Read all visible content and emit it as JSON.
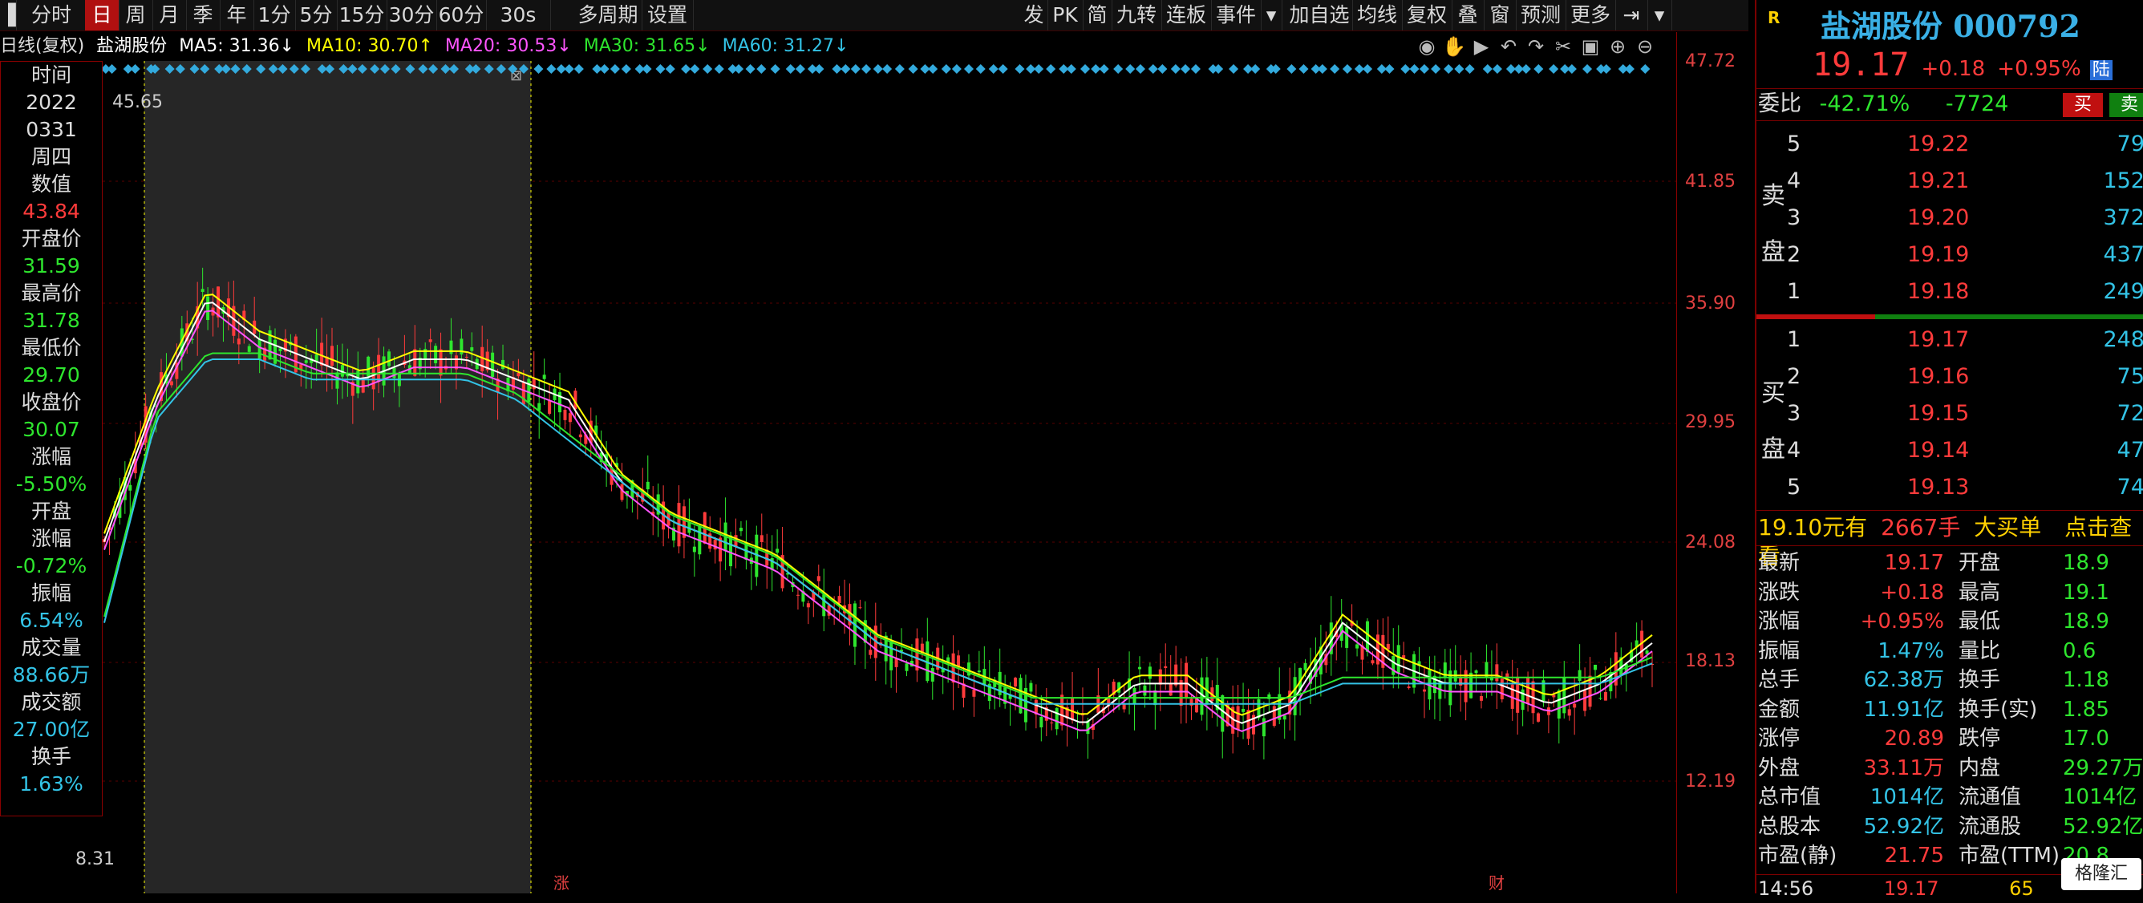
{
  "toolbar": {
    "left": [
      "分时",
      "日",
      "周",
      "月",
      "季",
      "年",
      "1分",
      "5分",
      "15分",
      "30分",
      "60分",
      "30s",
      "多周期",
      "设置"
    ],
    "right": [
      "发",
      "PK",
      "简",
      "九转",
      "连板",
      "事件",
      "加自选",
      "均线",
      "复权",
      "叠",
      "窗",
      "预测",
      "更多"
    ]
  },
  "ma_bar": {
    "period": "日线(复权)",
    "stock": "盐湖股份",
    "ma5": "MA5: 31.36↓",
    "ma10": "MA10: 30.70↑",
    "ma20": "MA20: 30.53↓",
    "ma30": "MA30: 31.65↓",
    "ma60": "MA60: 31.27↓"
  },
  "colors": {
    "up": "#ff3b3b",
    "down": "#2ee62e",
    "ma5": "#ffffff",
    "ma10": "#ffff00",
    "ma20": "#ff55ff",
    "ma30": "#2ee62e",
    "ma60": "#33c3e6",
    "axis": "#e04040"
  },
  "price_axis": [
    "47.72",
    "41.85",
    "35.90",
    "29.95",
    "24.08",
    "18.13",
    "12.19"
  ],
  "annotations": {
    "high": "45.65",
    "low": "8.31",
    "marker1": "涨",
    "marker2": "财"
  },
  "info_panel": [
    {
      "label": "时间",
      "value": "2022"
    },
    {
      "label": "",
      "value": "0331"
    },
    {
      "label": "周四",
      "value": ""
    },
    {
      "label": "数值",
      "value": "43.84"
    },
    {
      "label": "开盘价",
      "value": "31.59"
    },
    {
      "label": "最高价",
      "value": "31.78"
    },
    {
      "label": "最低价",
      "value": "29.70"
    },
    {
      "label": "收盘价",
      "value": "30.07"
    },
    {
      "label": "涨幅",
      "value": "-5.50%"
    },
    {
      "label": "开盘",
      "value": ""
    },
    {
      "label": "涨幅",
      "value": "-0.72%"
    },
    {
      "label": "振幅",
      "value": "6.54%"
    },
    {
      "label": "成交量",
      "value": "88.66万"
    },
    {
      "label": "成交额",
      "value": "27.00亿"
    },
    {
      "label": "换手",
      "value": "1.63%"
    }
  ],
  "quote": {
    "badge": "R",
    "name": "盐湖股份",
    "code": "000792",
    "price": "19.17",
    "change": "+0.18",
    "pct": "+0.95%",
    "market": "陆",
    "weibi_label": "委比",
    "weibi": "-42.71%",
    "weicha": "-7724",
    "buy_btn": "买",
    "sell_btn": "卖",
    "sell_side": "卖盘",
    "buy_side": "买盘",
    "asks": [
      {
        "lvl": "5",
        "price": "19.22",
        "vol": "79"
      },
      {
        "lvl": "4",
        "price": "19.21",
        "vol": "152"
      },
      {
        "lvl": "3",
        "price": "19.20",
        "vol": "372"
      },
      {
        "lvl": "2",
        "price": "19.19",
        "vol": "437"
      },
      {
        "lvl": "1",
        "price": "19.18",
        "vol": "249"
      }
    ],
    "bids": [
      {
        "lvl": "1",
        "price": "19.17",
        "vol": "248"
      },
      {
        "lvl": "2",
        "price": "19.16",
        "vol": "75"
      },
      {
        "lvl": "3",
        "price": "19.15",
        "vol": "72"
      },
      {
        "lvl": "4",
        "price": "19.14",
        "vol": "47"
      },
      {
        "lvl": "5",
        "price": "19.13",
        "vol": "74"
      }
    ],
    "bigorder": {
      "price": "19.10元有",
      "qty": "2667手",
      "label": "大买单",
      "link": "点击查看"
    },
    "stats": [
      {
        "l1": "最新",
        "v1": "19.17",
        "l2": "开盘",
        "v2": "18.9"
      },
      {
        "l1": "涨跌",
        "v1": "+0.18",
        "l2": "最高",
        "v2": "19.1"
      },
      {
        "l1": "涨幅",
        "v1": "+0.95%",
        "l2": "最低",
        "v2": "18.9"
      },
      {
        "l1": "振幅",
        "v1": "1.47%",
        "l2": "量比",
        "v2": "0.6"
      },
      {
        "l1": "总手",
        "v1": "62.38万",
        "l2": "换手",
        "v2": "1.18"
      },
      {
        "l1": "金额",
        "v1": "11.91亿",
        "l2": "换手(实)",
        "v2": "1.85"
      },
      {
        "l1": "涨停",
        "v1": "20.89",
        "l2": "跌停",
        "v2": "17.0"
      },
      {
        "l1": "外盘",
        "v1": "33.11万",
        "l2": "内盘",
        "v2": "29.27万"
      },
      {
        "l1": "总市值",
        "v1": "1014亿",
        "l2": "流通值",
        "v2": "1014亿"
      },
      {
        "l1": "总股本",
        "v1": "52.92亿",
        "l2": "流通股",
        "v2": "52.92亿"
      },
      {
        "l1": "市盈(静)",
        "v1": "21.75",
        "l2": "市盈(TTM)",
        "v2": "20.8"
      }
    ],
    "tick": {
      "time": "14:56",
      "price": "19.17",
      "vol": "65"
    },
    "watermark": "格隆汇"
  },
  "chart_data": {
    "type": "line",
    "ylim": [
      12.19,
      47.72
    ],
    "series": [
      {
        "name": "MA5",
        "values": [
          24,
          31,
          36,
          34,
          33,
          32,
          33,
          33,
          32,
          31,
          27,
          25,
          24,
          23,
          21,
          19,
          18,
          17,
          16,
          15,
          17,
          17,
          15,
          16,
          20,
          18,
          17,
          17,
          16,
          17,
          19
        ]
      },
      {
        "name": "MA60",
        "values": [
          20,
          30,
          33,
          33,
          32,
          32,
          32,
          32,
          31,
          29,
          27,
          25,
          24,
          23,
          21,
          19,
          18,
          17,
          16,
          16,
          16,
          16,
          16,
          16,
          17,
          17,
          17,
          17,
          17,
          17,
          18
        ]
      }
    ]
  }
}
